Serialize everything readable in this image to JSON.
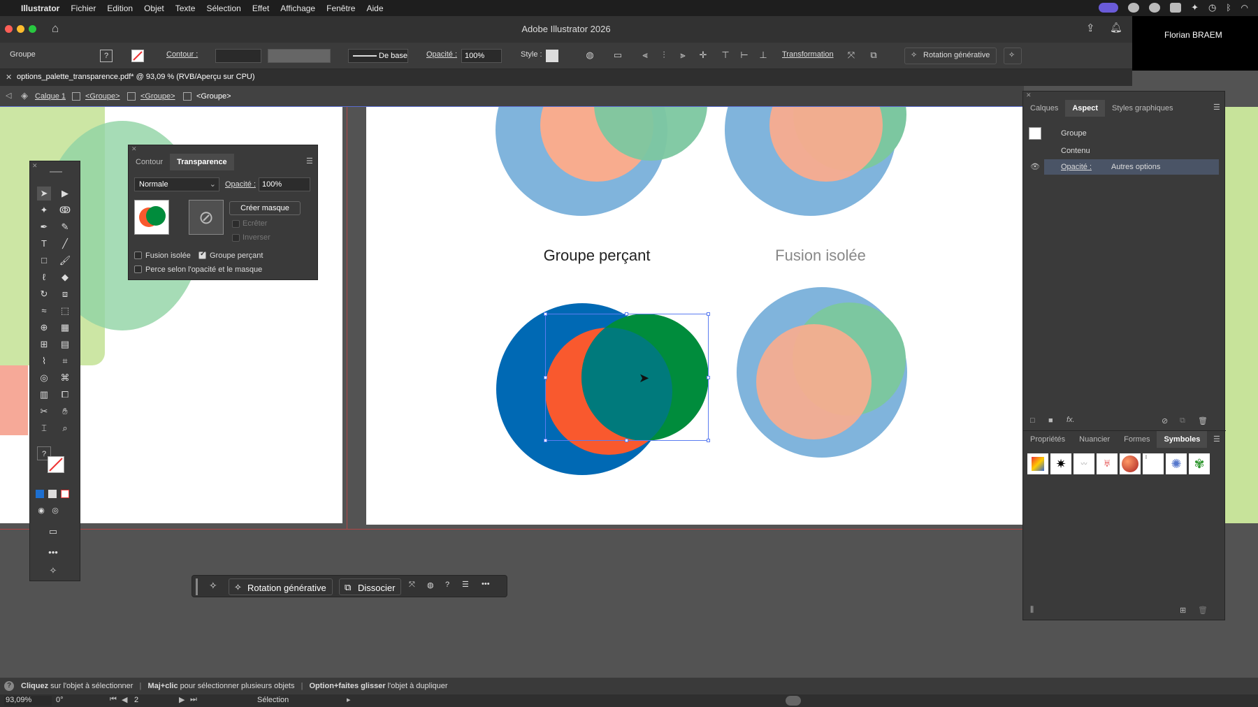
{
  "menubar": {
    "app_name": "Illustrator",
    "items": [
      "Fichier",
      "Edition",
      "Objet",
      "Texte",
      "Sélection",
      "Effet",
      "Affichage",
      "Fenêtre",
      "Aide"
    ]
  },
  "window": {
    "title": "Adobe Illustrator 2026",
    "user": "Florian BRAEM"
  },
  "control_bar": {
    "selection_type": "Groupe",
    "stroke_label": "Contour :",
    "stroke_style": "De base",
    "opacity_label": "Opacité :",
    "opacity_value": "100%",
    "style_label": "Style :",
    "transform_label": "Transformation",
    "generative_button": "Rotation générative"
  },
  "document": {
    "tab_title": "options_palette_transparence.pdf* @ 93,09 % (RVB/Aperçu sur CPU)"
  },
  "breadcrumb": [
    "Calque 1",
    "<Groupe>",
    "<Groupe>",
    "<Groupe>"
  ],
  "artwork": {
    "caption_left": "Groupe perçant",
    "caption_right": "Fusion isolée",
    "colors": {
      "light_blue": "#80b4dc",
      "salmon": "#f8ac8e",
      "light_green": "#7cc7a0",
      "dark_blue": "#0069b4",
      "orange": "#f9592e",
      "green": "#008c3c",
      "teal_overlap": "#007a7c"
    }
  },
  "transparency_panel": {
    "tabs": [
      "Contour",
      "Transparence"
    ],
    "active_tab": "Transparence",
    "blend_mode": "Normale",
    "opacity_label": "Opacité :",
    "opacity_value": "100%",
    "create_mask_button": "Créer masque",
    "clip_label": "Ecrêter",
    "invert_label": "Inverser",
    "isolated_blend_label": "Fusion isolée",
    "isolated_blend_checked": false,
    "knockout_group_label": "Groupe perçant",
    "knockout_group_checked": true,
    "knockout_opacity_label": "Perce selon l'opacité et le masque",
    "knockout_opacity_checked": false
  },
  "right_panel": {
    "tabs": [
      "Calques",
      "Aspect",
      "Styles graphiques"
    ],
    "active_tab": "Aspect",
    "rows": {
      "group": "Groupe",
      "content": "Contenu",
      "opacity_label": "Opacité :",
      "opacity_value": "Autres options"
    },
    "bottom_tabs": [
      "Propriétés",
      "Nuancier",
      "Formes",
      "Symboles"
    ],
    "active_bottom_tab": "Symboles",
    "fx_label": "fx."
  },
  "contextual_bar": {
    "generative_button": "Rotation générative",
    "ungroup_button": "Dissocier"
  },
  "hint_bar": {
    "part1_bold": "Cliquez",
    "part1": " sur l'objet à sélectionner",
    "part2_bold": "Maj+clic",
    "part2": " pour sélectionner plusieurs objets",
    "part3_bold": "Option+faites glisser",
    "part3": " l'objet à dupliquer"
  },
  "status_bar": {
    "zoom": "93,09%",
    "rotation": "0°",
    "page": "2",
    "tool": "Sélection"
  }
}
